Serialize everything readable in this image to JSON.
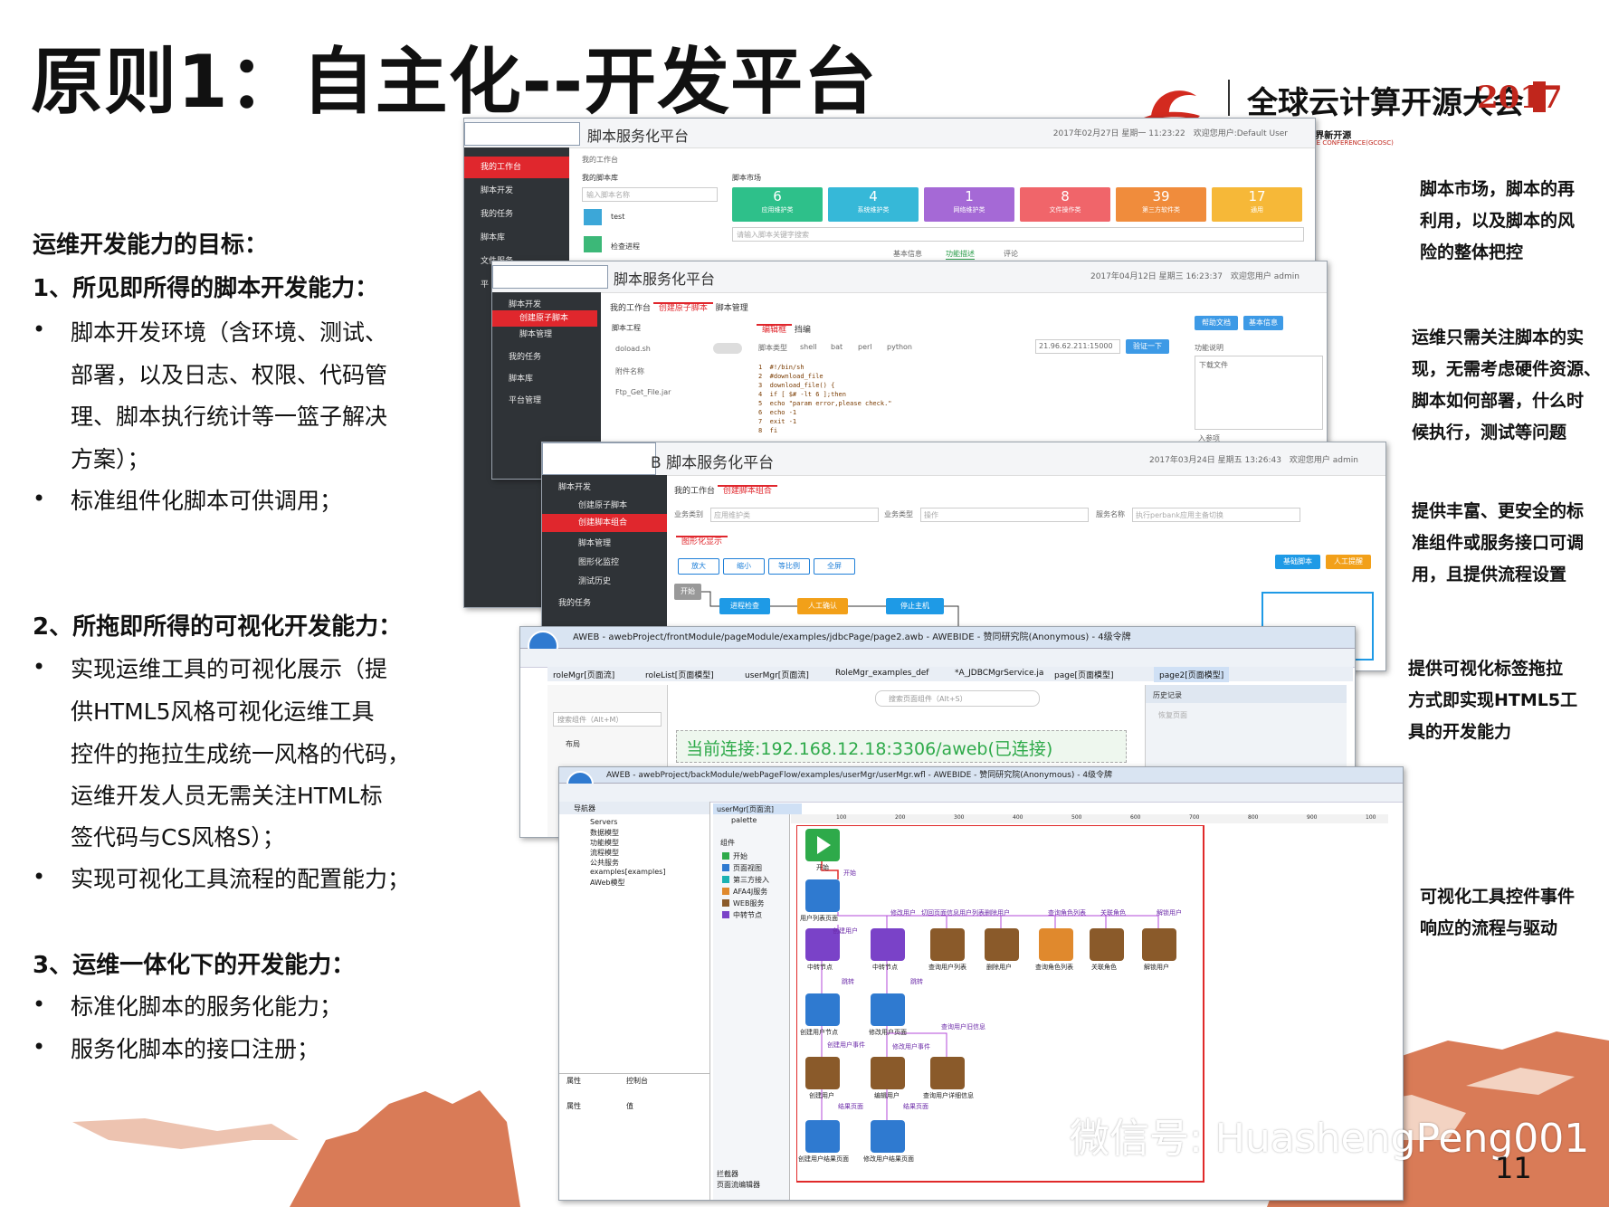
{
  "slide": {
    "title": "原则1：自主化--开发平台",
    "page_number": "11",
    "watermark": "微信号: HuashengPeng001",
    "logo_text": "全球云计算开源大会",
    "logo_year": "2017",
    "logo_subtext": "力, 拥抱全世界新开源",
    "logo_subtext2": "PUTING OPEN SOURCE CONFERENCE(GCOSC)"
  },
  "left": {
    "section1_heading": "运维开发能力的目标：",
    "s1_title": "1、所见即所得的脚本开发能力：",
    "s1_b1_l1": "脚本开发环境（含环境、测试、",
    "s1_b1_l2": "部署，以及日志、权限、代码管",
    "s1_b1_l3": "理、脚本执行统计等一篮子解决",
    "s1_b1_l4": "方案）；",
    "s1_b2": "标准组件化脚本可供调用；",
    "s2_title": "2、所拖即所得的可视化开发能力：",
    "s2_b1_l1": "实现运维工具的可视化展示（提",
    "s2_b1_l2": "供HTML5风格可视化运维工具",
    "s2_b1_l3": "控件的拖拉生成统一风格的代码，",
    "s2_b1_l4": "运维开发人员无需关注HTML标",
    "s2_b1_l5": "签代码与CS风格S）；",
    "s2_b2": "实现可视化工具流程的配置能力；",
    "s3_title": "3、运维一体化下的开发能力：",
    "s3_b1": "标准化脚本的服务化能力；",
    "s3_b2": "服务化脚本的接口注册；",
    "bullet": "•"
  },
  "right": {
    "a1": [
      "脚本市场，脚本的再",
      "利用，以及脚本的风",
      "险的整体把控"
    ],
    "a2": [
      "运维只需关注脚本的实",
      "现，无需考虑硬件资源、",
      "脚本如何部署，什么时",
      "候执行，测试等问题"
    ],
    "a3": [
      "提供丰富、更安全的标",
      "准组件或服务接口可调",
      "用，且提供流程设置"
    ],
    "a4": [
      "提供可视化标签拖拉",
      "方式即实现HTML5工",
      "具的开发能力"
    ],
    "a5": [
      "可视化工具控件事件",
      "响应的流程与驱动"
    ]
  },
  "shot1": {
    "app_title": "脚本服务化平台",
    "header_right": "2017年02月27日 星期一 11:23:22　欢迎您用户:Default User",
    "side": [
      "我的工作台",
      "脚本开发",
      "我的任务",
      "脚本库",
      "文件服务",
      "平"
    ],
    "breadcrumb": "我的工作台",
    "lib_title": "我的脚本库",
    "search_ph": "输入脚本名称",
    "lib_items": [
      "test",
      "检查进程"
    ],
    "market_title": "脚本市场",
    "cards": [
      {
        "n": "6",
        "l": "应用维护类",
        "color": "#2ec08a"
      },
      {
        "n": "4",
        "l": "系统维护类",
        "color": "#36b8d8"
      },
      {
        "n": "1",
        "l": "网络维护类",
        "color": "#a569d6"
      },
      {
        "n": "8",
        "l": "文件操作类",
        "color": "#f0656a"
      },
      {
        "n": "39",
        "l": "第三方软件类",
        "color": "#f08c3c"
      },
      {
        "n": "17",
        "l": "通用",
        "color": "#f6b838"
      }
    ],
    "market_search": "请输入脚本关键字搜索",
    "detail_tabs": [
      "基本信息",
      "功能描述",
      "评论"
    ]
  },
  "shot2": {
    "app_title": "脚本服务化平台",
    "header_right": "2017年04月12日 星期三 16:23:37　欢迎您用户 admin",
    "side": [
      "脚本开发",
      "创建原子脚本",
      "脚本管理",
      "我的任务",
      "脚本库",
      "平台管理"
    ],
    "tabs": [
      "我的工作台",
      "创建原子脚本",
      "脚本管理"
    ],
    "project": "脚本工程",
    "file1": "doload.sh",
    "attach": "附件名称",
    "file2": "Ftp_Get_File.jar",
    "edit_tabs": [
      "编辑框",
      "挡编"
    ],
    "script_type": "脚本类型",
    "types": [
      "shell",
      "bat",
      "perl",
      "python"
    ],
    "server": "21.96.62.211:15000",
    "run_btn": "验证一下",
    "help_btn": "帮助文档",
    "info_btn": "基本信息",
    "func_desc": "功能说明",
    "download": "下载文件",
    "code": "1  #!/bin/sh\n2  #download_file\n3  download_file() {\n4  if [ $# -lt 6 ];then\n5  echo \"param error,please check.\"\n6  echo -1\n7  exit -1\n8  fi",
    "params": "入参项"
  },
  "shot3": {
    "app_title": "B  脚本服务化平台",
    "header_right": "2017年03月24日 星期五 13:26:43　欢迎您用户 admin",
    "side": [
      "脚本开发",
      "创建原子脚本",
      "创建脚本组合",
      "脚本管理",
      "图形化监控",
      "测试历史",
      "我的任务"
    ],
    "tabs": [
      "我的工作台",
      "创建脚本组合"
    ],
    "biz_type": "业务类别",
    "biz_val": "应用维护类",
    "biz_type2": "业务类型",
    "biz_val2": "操作",
    "svc_name": "服务名称",
    "svc_val": "执行perbank应用主备切换",
    "graph_tab": "图形化显示",
    "tools": [
      "放大",
      "缩小",
      "等比例",
      "全屏"
    ],
    "btn_basic": "基础脚本",
    "btn_manual": "人工提醒",
    "flow": [
      "开始",
      "进程检查",
      "人工确认",
      "停止主机"
    ]
  },
  "shot4": {
    "window_title": "AWEB - awebProject/frontModule/pageModule/examples/jdbcPage/page2.awb - AWEBIDE - 赞同研究院(Anonymous) - 4级令牌",
    "tabs": [
      "roleMgr[页面流]",
      "roleList[页面模型]",
      "userMgr[页面流]",
      "RoleMgr_examples_def",
      "*A_JDBCMgrService.ja",
      "page[页面模型]",
      "page2[页面模型]"
    ],
    "search_ph": "搜索组件（Alt+M）",
    "search2": "搜索页面组件（Alt+S）",
    "layout": "布局",
    "conn": "当前连接:192.168.12.18:3306/aweb(已连接)",
    "history": "历史记录",
    "restore": "恢复页面"
  },
  "shot5": {
    "window_title": "AWEB - awebProject/backModule/webPageFlow/examples/userMgr/userMgr.wfl - AWEBIDE - 赞同研究院(Anonymous) - 4级令牌",
    "nav_title": "导航器",
    "tree": [
      "Servers",
      "数据模型",
      "功能模型",
      "流程模型",
      "公共服务",
      "examples[examples]",
      "AWeb模型"
    ],
    "editor_tab": "userMgr[页面流]",
    "palette": "palette",
    "palette_group": "组件",
    "palette_items": [
      "开始",
      "页面视图",
      "第三方接入",
      "AFA4J服务",
      "WEB服务",
      "中转节点"
    ],
    "props_tab": "属性",
    "console_tab": "控制台",
    "prop_col": "属性",
    "val_col": "值",
    "bottom1": "拦截器",
    "bottom2": "页面流编辑器",
    "ruler": [
      "100",
      "200",
      "300",
      "400",
      "500",
      "600",
      "700",
      "800",
      "900",
      "100"
    ],
    "vruler": [
      "100",
      "200",
      "300",
      "400",
      "500"
    ],
    "nodes": {
      "start": "开始",
      "list": "用户列表页面",
      "t1": "中转节点",
      "t2": "中转节点",
      "q1": "查询用户列表",
      "d1": "删除用户",
      "q2": "查询角色列表",
      "r1": "关联角色",
      "u1": "解锁用户",
      "cp": "创建用户节点",
      "mp": "修改用户页面",
      "cu": "创建用户",
      "eu": "编辑用户",
      "qd": "查询用户详细信息",
      "cr": "创建用户结果页面",
      "mr": "修改用户结果页面"
    },
    "edges": {
      "start": "开始",
      "create": "创建用户",
      "modify": "修改用户",
      "jump1": "跳转",
      "jump2": "跳转",
      "switch": "切回页面信息用户列表删除用户",
      "qlist": "查询角色列表",
      "rel": "关联角色",
      "unlock": "解锁用户",
      "cevent": "创建用户事件",
      "mevent": "修改用户事件",
      "qinfo": "查询用户旧信息",
      "res1": "结果页面",
      "res2": "结果页面"
    }
  }
}
